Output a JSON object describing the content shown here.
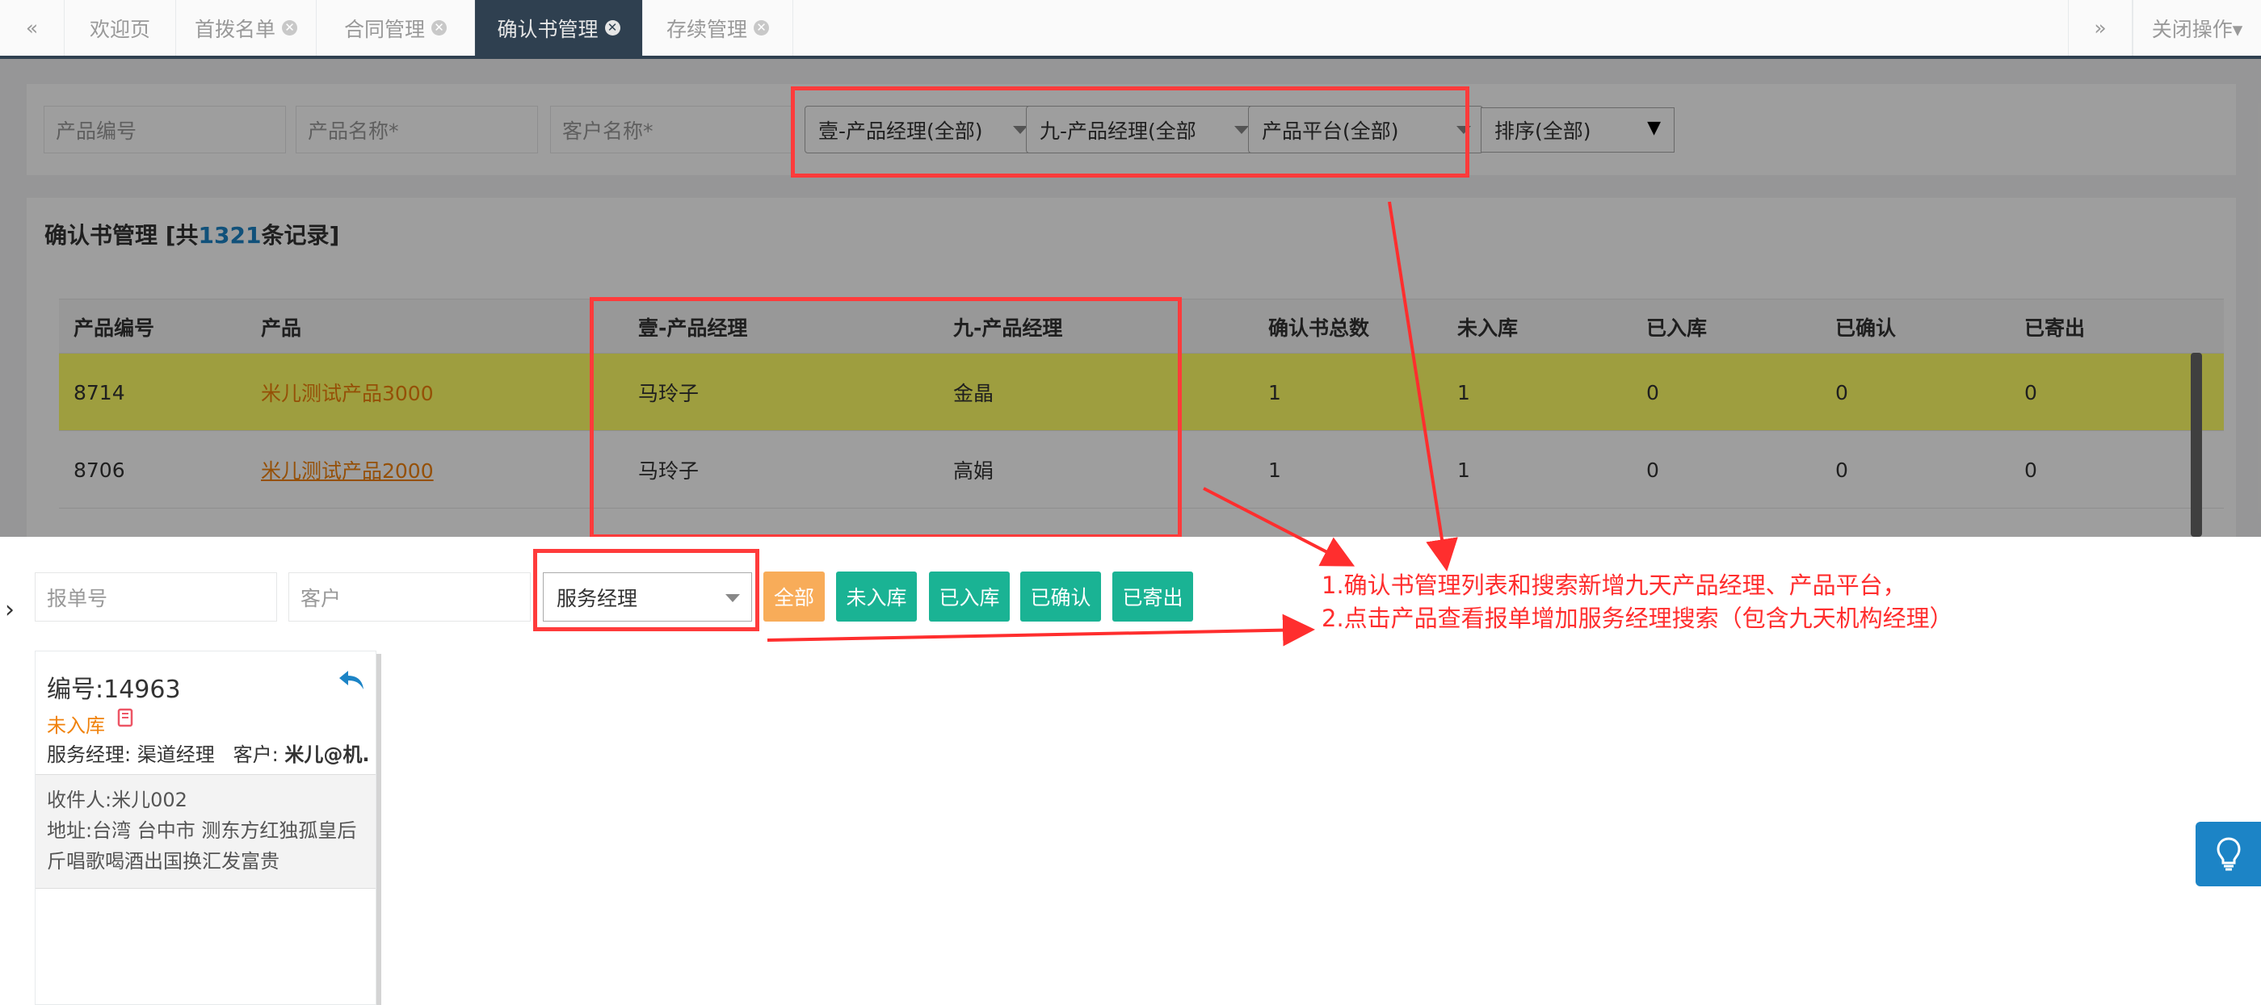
{
  "tabs": {
    "prev": "«",
    "next": "»",
    "items": [
      {
        "label": "欢迎页"
      },
      {
        "label": "首拨名单"
      },
      {
        "label": "合同管理"
      },
      {
        "label": "确认书管理"
      },
      {
        "label": "存续管理"
      }
    ],
    "close_ops": "关闭操作▾"
  },
  "filters": {
    "product_code_placeholder": "产品编号",
    "product_name_placeholder": "产品名称*",
    "customer_name_placeholder": "客户名称*",
    "manager_yi": "壹-产品经理(全部)",
    "manager_jiu": "九-产品经理(全部",
    "platform": "产品平台(全部)",
    "sort": "排序(全部)",
    "sort_caret": "▼"
  },
  "panel": {
    "title_prefix": "确认书管理 [共",
    "count": "1321",
    "title_suffix": "条记录]"
  },
  "table": {
    "headers": [
      "产品编号",
      "产品",
      "壹-产品经理",
      "九-产品经理",
      "确认书总数",
      "未入库",
      "已入库",
      "已确认",
      "已寄出"
    ],
    "rows": [
      [
        "8714",
        "米儿测试产品3000",
        "马玲子",
        "金晶",
        "1",
        "1",
        "0",
        "0",
        "0"
      ],
      [
        "8706",
        "米儿测试产品2000",
        "马玲子",
        "高娟",
        "1",
        "1",
        "0",
        "0",
        "0"
      ]
    ]
  },
  "lower": {
    "expander": "›",
    "order_placeholder": "报单号",
    "customer_placeholder": "客户",
    "service_manager": "服务经理",
    "buttons": [
      "全部",
      "未入库",
      "已入库",
      "已确认",
      "已寄出"
    ]
  },
  "card": {
    "number": "编号:14963",
    "status": "未入库",
    "service_manager": "服务经理: 渠道经理",
    "customer_label": "客户: ",
    "customer_value": "米儿@机..",
    "recipient": "收件人:米儿002",
    "address": "地址:台湾 台中市 测东方红独孤皇后斤唱歌喝酒出国换汇发富贵"
  },
  "annotation": {
    "line1": "1.确认书管理列表和搜索新增九天产品经理、产品平台，",
    "line2": "2.点击产品查看报单增加服务经理搜索（包含九天机构经理）"
  },
  "colors": {
    "nav_dark": "#2f4050",
    "primary_green": "#1ab394",
    "warning_orange": "#f8ac59",
    "link_orange": "#f0820c",
    "highlight_yellow": "#ffff66",
    "annotation_red": "#ff2e2e",
    "info_blue": "#1c84c6"
  },
  "icons": [
    "close-icon",
    "reply-arrow-icon",
    "book-icon",
    "lightbulb-icon",
    "caret-down-icon",
    "chevron-right-icon"
  ]
}
